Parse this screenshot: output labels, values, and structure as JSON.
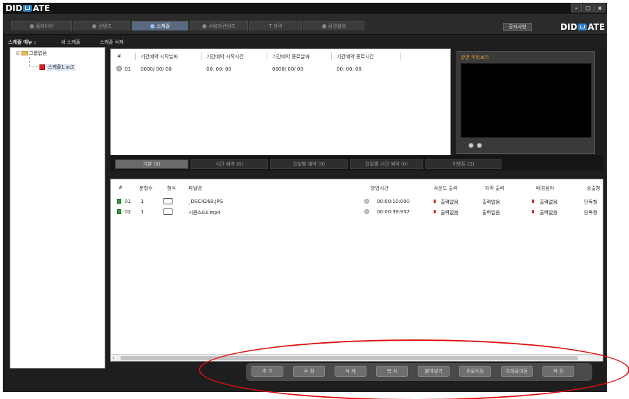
{
  "app": {
    "logo_left": "DID",
    "logo_right": "ATE"
  },
  "window_controls": {
    "minimize": "–",
    "maximize": "□",
    "close": "x"
  },
  "main_tabs": [
    {
      "label": "플레이어",
      "icon": "player-icon"
    },
    {
      "label": "컨텐츠",
      "icon": "content-icon"
    },
    {
      "label": "스케쥴",
      "icon": "clock-icon"
    },
    {
      "label": "사용자컨텐츠",
      "icon": "user-content-icon"
    },
    {
      "label": "T 자막",
      "icon": "caption-icon"
    },
    {
      "label": "환경설정",
      "icon": "settings-icon"
    }
  ],
  "header": {
    "notice_button": "공지사항"
  },
  "schedule_menu": {
    "label": "스케쥴 메뉴 :",
    "new": "새 스케쥴",
    "delete": "스케쥴 삭제"
  },
  "tree": {
    "group": "그룹없음",
    "schedule_file": "스케쥴1.sc2"
  },
  "period_table": {
    "headers": [
      "#",
      "기간예약 시작날짜",
      "기간예약 시작시간",
      "기간예약 종료날짜",
      "기간예약 종료시간"
    ],
    "rows": [
      {
        "no": "01",
        "start_date": "0000/ 00/ 00",
        "start_time": "00: 00: 00",
        "end_date": "0000/ 00/ 00",
        "end_time": "00: 00: 00"
      }
    ]
  },
  "preview": {
    "title": "장면 미리보기"
  },
  "sub_tabs": [
    {
      "label": "기본 (0)"
    },
    {
      "label": "시간 예약 (0)"
    },
    {
      "label": "요일별 예약 (0)"
    },
    {
      "label": "요일별 시간 예약 (0)"
    },
    {
      "label": "이벤트 (0)"
    }
  ],
  "content_list": {
    "headers": [
      "#",
      "분할수",
      "형식",
      "파일명",
      "방영시간",
      "사운드 출력",
      "자막 출력",
      "배경음악",
      "송출형"
    ],
    "rows": [
      {
        "no": "01",
        "split": "1",
        "filename": "_DSC4268.JPG",
        "duration": "00:00:10:000",
        "sound": "출력없음",
        "caption": "출력없음",
        "bgm": "출력없음",
        "output": "단독형"
      },
      {
        "no": "02",
        "split": "1",
        "filename": "시퀀스03.mp4",
        "duration": "00:00:39:957",
        "sound": "출력없음",
        "caption": "출력없음",
        "bgm": "출력없음",
        "output": "단독형"
      }
    ]
  },
  "action_buttons": [
    "추 가",
    "수 정",
    "삭 제",
    "복 사",
    "붙여넣기",
    "위로이동",
    "아래로이동",
    "저 장"
  ],
  "colors": {
    "window_bg": "#1e1e1e",
    "active_tab": "#5a6a80",
    "highlight": "#e01010",
    "preview_title": "#e0a030"
  }
}
